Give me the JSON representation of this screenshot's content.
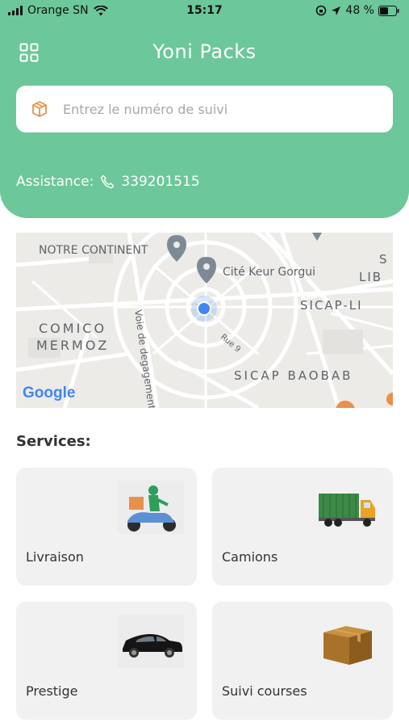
{
  "status_bar": {
    "carrier": "Orange SN",
    "time": "15:17",
    "battery": "48 %"
  },
  "header": {
    "title": "Yoni Packs",
    "search_placeholder": "Entrez le numéro de suivi",
    "assistance_label": "Assistance:",
    "assistance_phone": "339201515"
  },
  "map": {
    "labels": {
      "notre_continent": "NOTRE CONTINENT",
      "cite_keur_gorgui": "Cité Keur Gorgui",
      "sicap_lib_1": "S",
      "sicap_lib_2": "LIB",
      "sicap_li": "SICAP-LI",
      "comico_1": "COMICO",
      "comico_2": "MERMOZ",
      "voie": "Voie de degagement",
      "rue": "Rue 9",
      "sicap_baobab": "SICAP BAOBAB",
      "google": "Google"
    }
  },
  "services": {
    "title": "Services:",
    "items": [
      {
        "label": "Livraison",
        "icon": "scooter-delivery-icon"
      },
      {
        "label": "Camions",
        "icon": "truck-icon"
      },
      {
        "label": "Prestige",
        "icon": "luxury-car-icon"
      },
      {
        "label": "Suivi courses",
        "icon": "cardboard-box-icon"
      }
    ]
  },
  "colors": {
    "primary_green": "#6cc79a",
    "accent_orange": "#e8914a",
    "card_bg": "#f1f1f1",
    "location_blue": "#4285f4"
  }
}
